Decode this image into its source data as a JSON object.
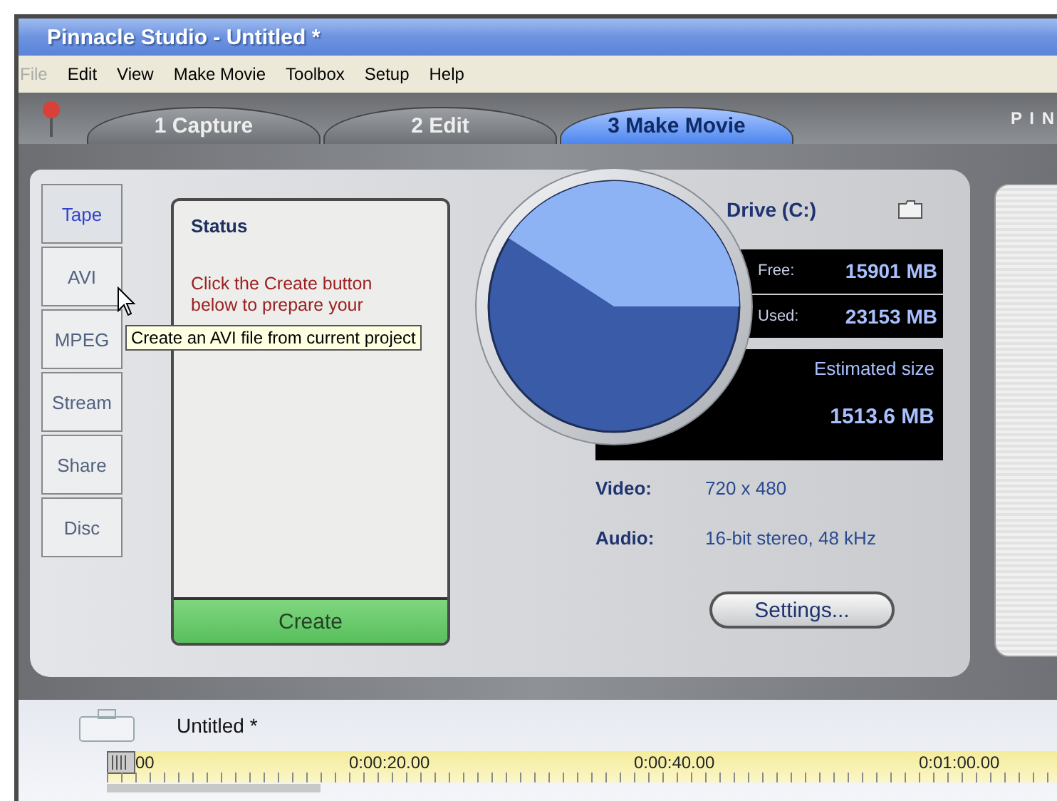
{
  "window": {
    "title": "Pinnacle Studio - Untitled *"
  },
  "menu": [
    {
      "label": "File",
      "disabled": true
    },
    {
      "label": "Edit",
      "disabled": false
    },
    {
      "label": "View",
      "disabled": false
    },
    {
      "label": "Make Movie",
      "disabled": false
    },
    {
      "label": "Toolbox",
      "disabled": false
    },
    {
      "label": "Setup",
      "disabled": false
    },
    {
      "label": "Help",
      "disabled": false
    }
  ],
  "mode_tabs": [
    {
      "label": "1 Capture",
      "selected": false
    },
    {
      "label": "2 Edit",
      "selected": false
    },
    {
      "label": "3 Make Movie",
      "selected": true
    }
  ],
  "brand": "P I N",
  "output_tabs": [
    {
      "label": "Tape",
      "selected": true
    },
    {
      "label": "AVI",
      "selected": false
    },
    {
      "label": "MPEG",
      "selected": false
    },
    {
      "label": "Stream",
      "selected": false
    },
    {
      "label": "Share",
      "selected": false
    },
    {
      "label": "Disc",
      "selected": false
    }
  ],
  "status": {
    "title": "Status",
    "message": "Click the Create button below to prepare your",
    "button": "Create"
  },
  "tooltip": "Create an AVI file from current project",
  "drive": {
    "label": "Drive (C:)",
    "free_label": "Free:",
    "free": "15901 MB",
    "used_label": "Used:",
    "used": "23153 MB",
    "estimated_label": "Estimated size",
    "estimated": "1513.6 MB"
  },
  "specs": [
    {
      "label": "Video:",
      "value": "720 x 480"
    },
    {
      "label": "Audio:",
      "value": "16-bit stereo, 48 kHz"
    }
  ],
  "settings_button": "Settings...",
  "project": {
    "title": "Untitled *"
  },
  "timeline": {
    "ticks": [
      "00",
      "0:00:20.00",
      "0:00:40.00",
      "0:01:00.00"
    ]
  }
}
